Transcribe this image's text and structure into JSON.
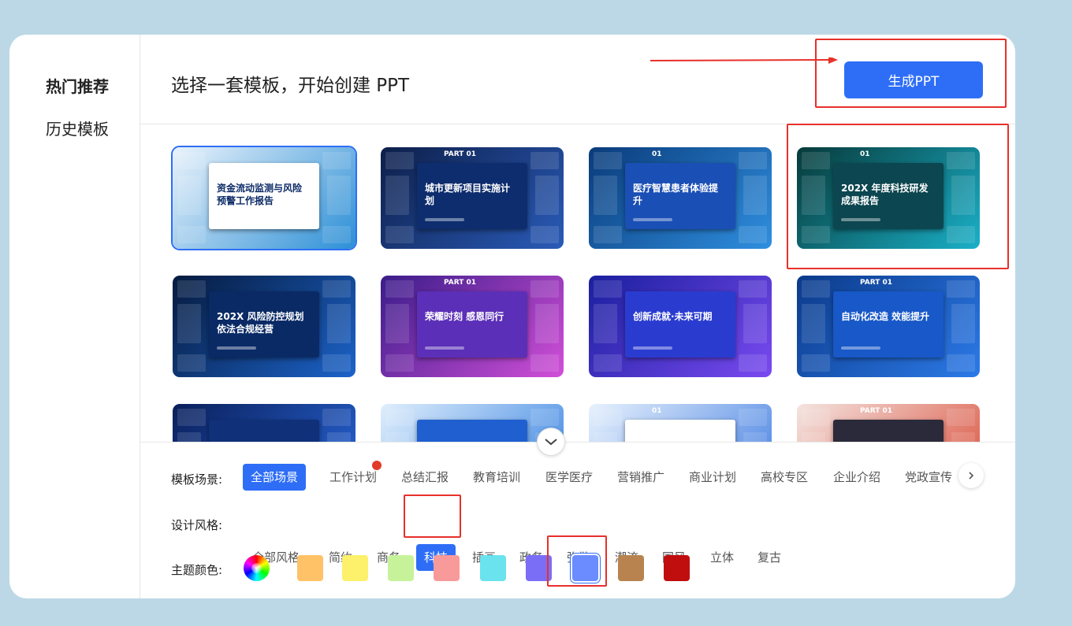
{
  "sidebar": {
    "items": [
      {
        "label": "热门推荐",
        "active": true
      },
      {
        "label": "历史模板",
        "active": false
      }
    ]
  },
  "header": {
    "title": "选择一套模板，开始创建 PPT",
    "generate_label": "生成PPT"
  },
  "templates": [
    {
      "title": "资金流动监测与风险预警工作报告",
      "top_label": "",
      "colors": [
        "#eaf3fb",
        "#2c8fd6"
      ],
      "card": "#ffffff",
      "dark": true
    },
    {
      "title": "城市更新项目实施计划",
      "top_label": "PART 01",
      "colors": [
        "#0d1f4a",
        "#2a5bb8"
      ],
      "card": "#0e2d6e",
      "dark": false
    },
    {
      "title": "医疗智慧患者体验提升",
      "top_label": "01",
      "colors": [
        "#0a3b7a",
        "#2f8fe0"
      ],
      "card": "#1a4fb5",
      "dark": false
    },
    {
      "title": "202X 年度科技研发成果报告",
      "top_label": "01",
      "colors": [
        "#073a3a",
        "#1ab0c8"
      ],
      "card": "#0c4650",
      "dark": false
    },
    {
      "title": "202X 风险防控规划 依法合规经营",
      "top_label": "",
      "colors": [
        "#061a3e",
        "#1c63c9"
      ],
      "card": "#0a2a66",
      "dark": false
    },
    {
      "title": "荣耀时刻 感恩同行",
      "top_label": "PART 01",
      "colors": [
        "#3a1c8a",
        "#d24fd8"
      ],
      "card": "#5b2fb8",
      "dark": false
    },
    {
      "title": "创新成就·未来可期",
      "top_label": "",
      "colors": [
        "#1a1f9e",
        "#7a4af0"
      ],
      "card": "#2a3cd0",
      "dark": false
    },
    {
      "title": "自动化改造 效能提升",
      "top_label": "PART 01",
      "colors": [
        "#0b3a8a",
        "#2c7ae8"
      ],
      "card": "#1858c8",
      "dark": false
    },
    {
      "title": "",
      "top_label": "",
      "colors": [
        "#0a1f5a",
        "#2a6ae0"
      ],
      "card": "#10307a",
      "dark": false
    },
    {
      "title": "",
      "top_label": "",
      "colors": [
        "#dfeefc",
        "#2f7de0"
      ],
      "card": "#1f5fd0",
      "dark": false
    },
    {
      "title": "",
      "top_label": "01",
      "colors": [
        "#e8f2fd",
        "#3a78e0"
      ],
      "card": "#ffffff",
      "dark": true
    },
    {
      "title": "",
      "top_label": "PART 01",
      "colors": [
        "#f4e4e0",
        "#d94a36"
      ],
      "card": "#2a2a3a",
      "dark": false
    }
  ],
  "filters": {
    "scene": {
      "label": "模板场景:",
      "options": [
        "全部场景",
        "工作计划",
        "总结汇报",
        "教育培训",
        "医学医疗",
        "营销推广",
        "商业计划",
        "高校专区",
        "企业介绍",
        "党政宣传"
      ],
      "active": 0,
      "hot_index": 1
    },
    "style": {
      "label": "设计风格:",
      "options": [
        "全部风格",
        "简约",
        "商务",
        "科技",
        "插画",
        "政务",
        "弥散",
        "潮流",
        "国风",
        "立体",
        "复古"
      ],
      "active": 3
    },
    "color": {
      "label": "主题颜色:",
      "swatches": [
        "#ffc266",
        "#fdf06a",
        "#c6f39a",
        "#f99a9a",
        "#6ae3ee",
        "#7b6ef6",
        "#6b8cff",
        "#b8834f",
        "#c00d0d"
      ],
      "active": 6
    }
  },
  "colors": {
    "accent": "#2e6ef7",
    "annotation": "#e8302a"
  }
}
